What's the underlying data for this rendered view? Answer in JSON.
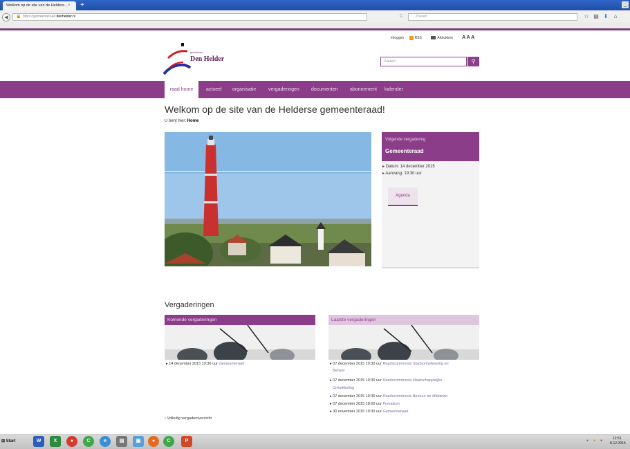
{
  "browser": {
    "tab_title": "Welkom op de site van de Helders...",
    "tab_close": "×",
    "new_tab": "+",
    "url_prefix": "https://gemeenteraad.",
    "url_host": "denhelder.nl",
    "search_placeholder": "Zoeken",
    "reload_icon": "C"
  },
  "site": {
    "utility": {
      "login": "Inloggen",
      "rss": "RSS",
      "print": "Afdrukken",
      "text_size": "A A A"
    },
    "logo": {
      "small": "gemeente",
      "name": "Den Helder"
    },
    "search_placeholder": "Zoeken...",
    "nav": [
      "raad home",
      "actueel",
      "organisatie",
      "vergaderingen",
      "documenten",
      "abonnement",
      "kalender"
    ],
    "welcome_title": "Welkom op de site van de Helderse gemeenteraad!",
    "breadcrumb_prefix": "U bent hier:",
    "breadcrumb_current": "Home",
    "next_meeting": {
      "label": "Volgende vergadering",
      "title": "Gemeenteraad",
      "date": "Datum: 14 december 2015",
      "time": "Aanvang: 19:30 uur",
      "agenda": "Agenda"
    },
    "meetings": {
      "title": "Vergaderingen",
      "upcoming_label": "Komende vergaderingen",
      "latest_label": "Laatste vergaderingen",
      "upcoming": [
        {
          "when": "14 december 2015 19:30 uur",
          "name": "Gemeenteraad"
        }
      ],
      "latest": [
        {
          "when": "07 december 2015 19:30 uur",
          "name": "Raadscommissie Stadsontwikkeling en",
          "name2": "Beheer"
        },
        {
          "when": "07 december 2015 19:30 uur",
          "name": "Raadscommissie Maatschappelijke",
          "name2": "Ontwikkeling"
        },
        {
          "when": "07 december 2015 19:30 uur",
          "name": "Raadscommissie Bestuur en Middelen"
        },
        {
          "when": "07 december 2015 18:00 uur",
          "name": "Presidium"
        },
        {
          "when": "30 november 2015 19:30 uur",
          "name": "Gemeenteraad"
        }
      ],
      "full_overview": "Volledig vergaderoverzicht"
    }
  },
  "taskbar": {
    "start": "Start",
    "clock_time": "12:51",
    "clock_date": "8-12-2015"
  },
  "colors": {
    "brand_purple": "#8c3d8a",
    "light_purple": "#dfc6df"
  }
}
